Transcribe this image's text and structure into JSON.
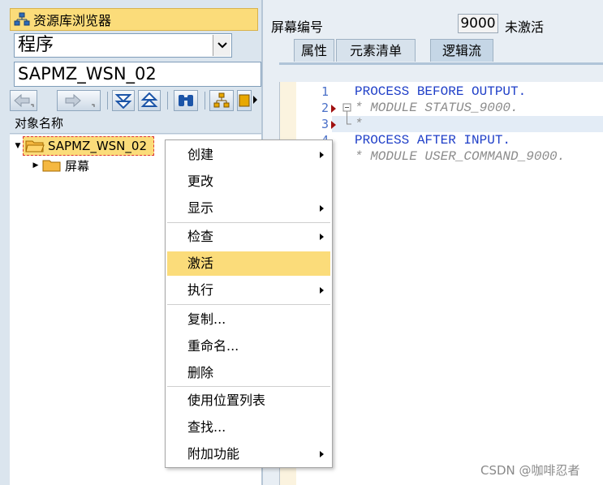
{
  "left": {
    "repo_title": "资源库浏览器",
    "type_select": "程序",
    "program_name": "SAPMZ_WSN_02",
    "tree_header": "对象名称",
    "tree": {
      "root": "SAPMZ_WSN_02",
      "child": "屏幕"
    }
  },
  "right": {
    "screen_label": "屏幕编号",
    "screen_number": "9000",
    "screen_status": "未激活",
    "tabs": [
      {
        "label": "属性"
      },
      {
        "label": "元素清单"
      },
      {
        "label": "逻辑流"
      }
    ],
    "active_tab": "逻辑流",
    "code": {
      "line_numbers": [
        "1",
        "2",
        "3",
        "4"
      ],
      "lines": [
        "PROCESS BEFORE OUTPUT.",
        "* MODULE STATUS_9000.",
        "*",
        "PROCESS AFTER INPUT.",
        "* MODULE USER_COMMAND_9000."
      ]
    }
  },
  "context_menu": {
    "items": [
      {
        "label": "创建",
        "submenu": true
      },
      {
        "label": "更改",
        "submenu": false
      },
      {
        "label": "显示",
        "submenu": true
      },
      {
        "label": "检查",
        "submenu": true
      },
      {
        "label": "激活",
        "submenu": false,
        "highlighted": true
      },
      {
        "label": "执行",
        "submenu": true
      },
      {
        "label": "复制...",
        "submenu": false
      },
      {
        "label": "重命名...",
        "submenu": false
      },
      {
        "label": "删除",
        "submenu": false
      },
      {
        "label": "使用位置列表",
        "submenu": false
      },
      {
        "label": "查找...",
        "submenu": false
      },
      {
        "label": "附加功能",
        "submenu": true
      }
    ]
  },
  "watermark": "CSDN @咖啡忍者",
  "colors": {
    "highlight": "#fbdc7a",
    "keyword": "#1f3fc8",
    "comment": "#8c8c8c",
    "pane_bg": "#dbe5ee"
  }
}
